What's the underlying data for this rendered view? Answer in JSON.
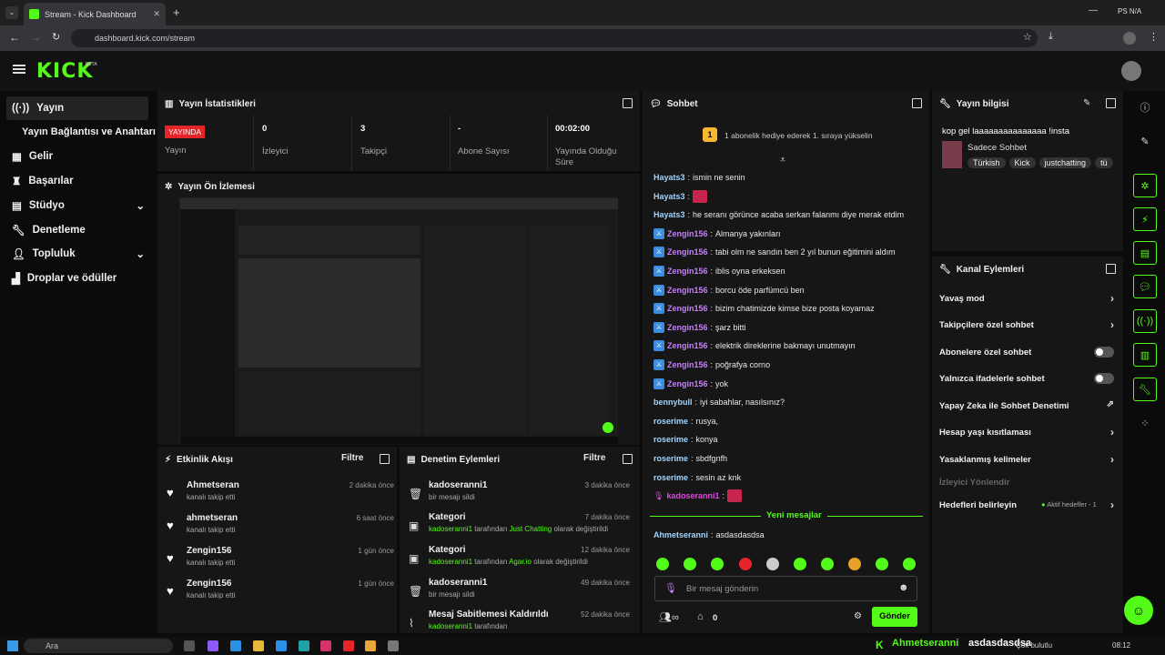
{
  "browser": {
    "tab_title": "Stream - Kick Dashboard",
    "url": "dashboard.kick.com/stream",
    "profile": "PS N/A"
  },
  "header": {
    "logo": "KICK",
    "logo_sup": "BETA"
  },
  "sidebar": {
    "items": [
      {
        "label": "Yayın",
        "icon": "stream-icon"
      },
      {
        "label": "Yayın Bağlantısı ve Anahtarı",
        "icon": ""
      },
      {
        "label": "Gelir",
        "icon": "chart-icon"
      },
      {
        "label": "Başarılar",
        "icon": "trophy-icon"
      },
      {
        "label": "Stüdyo",
        "icon": "grid-icon"
      },
      {
        "label": "Denetleme",
        "icon": "wrench-icon"
      },
      {
        "label": "Topluluk",
        "icon": "user-icon"
      },
      {
        "label": "Droplar ve ödüller",
        "icon": "gift-icon"
      }
    ]
  },
  "stats": {
    "title": "Yayın İstatistikleri",
    "live_badge": "YAYINDA",
    "live_label": "Yayın",
    "items": [
      {
        "value": "0",
        "label": "İzleyici"
      },
      {
        "value": "3",
        "label": "Takipçi"
      },
      {
        "value": "-",
        "label": "Abone Sayısı"
      },
      {
        "value": "00:02:00",
        "label": "Yayında Olduğu Süre"
      }
    ]
  },
  "preview": {
    "title": "Yayın Ön İzlemesi"
  },
  "activity": {
    "title": "Etkinlik Akışı",
    "filter": "Filtre",
    "events": [
      {
        "name": "Ahmetseran",
        "sub": "kanalı takip etti",
        "time": "2 dakika önce"
      },
      {
        "name": "ahmetseran",
        "sub": "kanalı takip etti",
        "time": "6 saat önce"
      },
      {
        "name": "Zengin156",
        "sub": "kanalı takip etti",
        "time": "1 gün önce"
      },
      {
        "name": "Zengin156",
        "sub": "kanalı takip etti",
        "time": "1 gün önce"
      }
    ]
  },
  "moderation": {
    "title": "Denetim Eylemleri",
    "filter": "Filtre",
    "items": [
      {
        "name": "kadoseranni1",
        "sub": "bir mesajı sildi",
        "time": "3 dakika önce",
        "icon": "trash-icon"
      },
      {
        "name": "Kategori",
        "sub_user": "kadoseranni1",
        "sub_mid": " tarafından ",
        "sub_val": "Just Chatting",
        "sub_end": " olarak değiştirildi",
        "time": "7 dakika önce",
        "icon": "category-icon"
      },
      {
        "name": "Kategori",
        "sub_user": "kadoseranni1",
        "sub_mid": " tarafından ",
        "sub_val": "Agar.io",
        "sub_end": " olarak değiştirildi",
        "time": "12 dakika önce",
        "icon": "category-icon"
      },
      {
        "name": "kadoseranni1",
        "sub": "bir mesajı sildi",
        "time": "49 dakika önce",
        "icon": "trash-icon"
      },
      {
        "name": "Mesaj Sabitlemesi Kaldırıldı",
        "sub_user": "kadoseranni1",
        "sub_mid": " tarafından",
        "time": "52 dakika önce",
        "icon": "unpin-icon"
      }
    ]
  },
  "chat": {
    "title": "Sohbet",
    "gift_text": "1 abonelik hediye ederek 1. sıraya yükselin",
    "messages": [
      {
        "user": "Hayats3",
        "color": "#9fd4ff",
        "badge": false,
        "text": "ismin ne senin"
      },
      {
        "user": "Hayats3",
        "color": "#9fd4ff",
        "badge": false,
        "text": ""
      },
      {
        "user": "Hayats3",
        "color": "#9fd4ff",
        "badge": false,
        "text": "he seranı görünce acaba serkan falanmı diye merak etdim"
      },
      {
        "user": "Zengin156",
        "color": "#c77dff",
        "badge": true,
        "text": "Almanya yakınları"
      },
      {
        "user": "Zengin156",
        "color": "#c77dff",
        "badge": true,
        "text": "tabi olm ne sandın ben 2 yıl bunun eğitimini aldım"
      },
      {
        "user": "Zengin156",
        "color": "#c77dff",
        "badge": true,
        "text": "iblis oyna erkeksen"
      },
      {
        "user": "Zengin156",
        "color": "#c77dff",
        "badge": true,
        "text": "borcu öde parfümcü ben"
      },
      {
        "user": "Zengin156",
        "color": "#c77dff",
        "badge": true,
        "text": "bizim chatimizde kimse bize posta koyamaz"
      },
      {
        "user": "Zengin156",
        "color": "#c77dff",
        "badge": true,
        "text": "şarz bitti"
      },
      {
        "user": "Zengin156",
        "color": "#c77dff",
        "badge": true,
        "text": "elektrik direklerine bakmayı unutmayın"
      },
      {
        "user": "Zengin156",
        "color": "#c77dff",
        "badge": true,
        "text": "poğrafya corno"
      },
      {
        "user": "Zengin156",
        "color": "#c77dff",
        "badge": true,
        "text": "yok"
      },
      {
        "user": "bennybull",
        "color": "#9fd4ff",
        "badge": false,
        "text": "iyi sabahlar, nasılsınız?"
      },
      {
        "user": "roserime",
        "color": "#9fd4ff",
        "badge": false,
        "text": "rusya,"
      },
      {
        "user": "roserime",
        "color": "#9fd4ff",
        "badge": false,
        "text": "konya"
      },
      {
        "user": "roserime",
        "color": "#9fd4ff",
        "badge": false,
        "text": "sbdfgnfh"
      },
      {
        "user": "roserime",
        "color": "#9fd4ff",
        "badge": false,
        "text": "sesin az knk"
      },
      {
        "user": "kadoseranni1",
        "color": "#d94cd9",
        "badge": false,
        "text": ""
      }
    ],
    "new_messages": "Yeni mesajlar",
    "last": {
      "user": "Ahmetseranni",
      "text": "asdasdasdsa"
    },
    "input_placeholder": "Bir mesaj gönderin",
    "viewer_count": "0",
    "send": "Gönder"
  },
  "info": {
    "title": "Yayın bilgisi",
    "stream_title": "kop gel laaaaaaaaaaaaaaa !insta",
    "category": "Sadece Sohbet",
    "tags": [
      "Türkish",
      "Kick",
      "justchatting",
      "tü"
    ]
  },
  "channel_actions": {
    "title": "Kanal Eylemleri",
    "items": [
      {
        "label": "Yavaş mod",
        "kind": "arrow"
      },
      {
        "label": "Takipçilere özel sohbet",
        "kind": "arrow"
      },
      {
        "label": "Abonelere özel sohbet",
        "kind": "toggle"
      },
      {
        "label": "Yalnızca ifadelerle sohbet",
        "kind": "toggle"
      },
      {
        "label": "Yapay Zeka ile Sohbet Denetimi",
        "kind": "ext"
      },
      {
        "label": "Hesap yaşı kısıtlaması",
        "kind": "arrow"
      },
      {
        "label": "Yasaklanmış kelimeler",
        "kind": "arrow"
      },
      {
        "label": "İzleyici Yönlendir",
        "kind": "disabled"
      },
      {
        "label": "Hedefleri belirleyin",
        "kind": "goal"
      }
    ],
    "goal_status": "Aktif hedefler - 1"
  },
  "taskbar": {
    "search": "Ara",
    "notification_user": "Ahmetseranni",
    "notification_text": "asdasdasdsa",
    "weather": "Çok bulutlu",
    "time": "08:12"
  },
  "colors": {
    "accent": "#53fc18",
    "live": "#e5252a"
  }
}
